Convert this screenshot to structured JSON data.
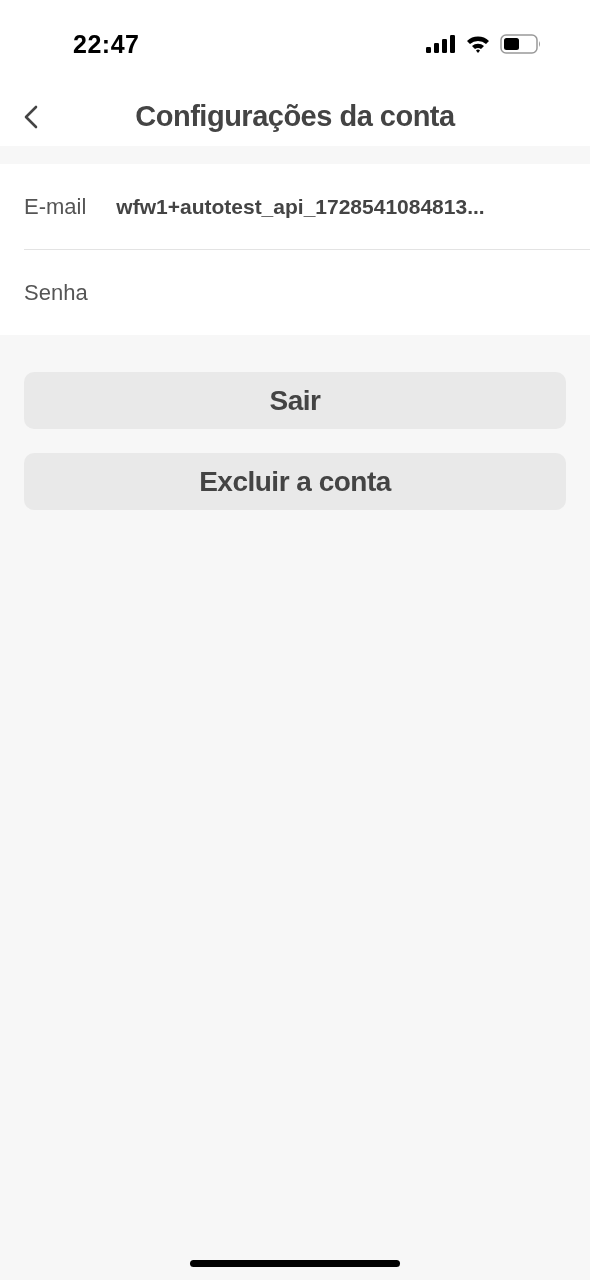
{
  "status_bar": {
    "time": "22:47"
  },
  "nav_bar": {
    "title": "Configurações da conta"
  },
  "settings": [
    {
      "label": "E-mail",
      "value": "wfw1+autotest_api_1728541084813..."
    },
    {
      "label": "Senha"
    }
  ],
  "buttons": [
    "Sair",
    "Excluir a conta"
  ]
}
